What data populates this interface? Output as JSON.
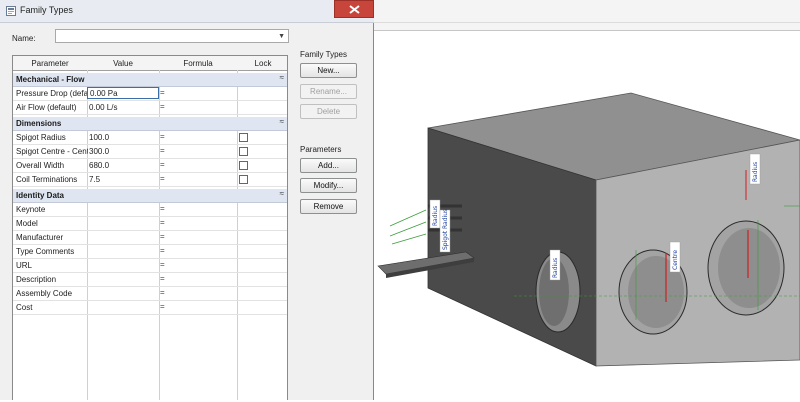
{
  "dialog": {
    "title": "Family Types",
    "name_label": "Name:",
    "name_value": ""
  },
  "table": {
    "headers": {
      "parameter": "Parameter",
      "value": "Value",
      "formula": "Formula",
      "lock": "Lock"
    },
    "groups": [
      {
        "name": "Mechanical - Flow",
        "rows": [
          {
            "parameter": "Pressure Drop (default)",
            "value": "0.00 Pa",
            "formula": "="
          },
          {
            "parameter": "Air Flow (default)",
            "value": "0.00 L/s",
            "formula": "="
          }
        ]
      },
      {
        "name": "Dimensions",
        "rows": [
          {
            "parameter": "Spigot Radius",
            "value": "100.0",
            "formula": "="
          },
          {
            "parameter": "Spigot Centre - Centre",
            "value": "300.0",
            "formula": "="
          },
          {
            "parameter": "Overall Width",
            "value": "680.0",
            "formula": "="
          },
          {
            "parameter": "Coil Terminations",
            "value": "7.5",
            "formula": "="
          }
        ]
      },
      {
        "name": "Identity Data",
        "rows": [
          {
            "parameter": "Keynote",
            "value": "",
            "formula": "="
          },
          {
            "parameter": "Model",
            "value": "",
            "formula": "="
          },
          {
            "parameter": "Manufacturer",
            "value": "",
            "formula": "="
          },
          {
            "parameter": "Type Comments",
            "value": "",
            "formula": "="
          },
          {
            "parameter": "URL",
            "value": "",
            "formula": "="
          },
          {
            "parameter": "Description",
            "value": "",
            "formula": "="
          },
          {
            "parameter": "Assembly Code",
            "value": "",
            "formula": "="
          },
          {
            "parameter": "Cost",
            "value": "",
            "formula": "="
          }
        ]
      }
    ]
  },
  "family_types": {
    "label": "Family Types",
    "new": "New...",
    "rename": "Rename...",
    "delete": "Delete"
  },
  "parameters": {
    "label": "Parameters",
    "add": "Add...",
    "modify": "Modify...",
    "remove": "Remove"
  },
  "viewport": {
    "dim_labels": [
      "Radius",
      "Spigot Radius",
      "Radius",
      "Centre",
      "Radius"
    ]
  }
}
